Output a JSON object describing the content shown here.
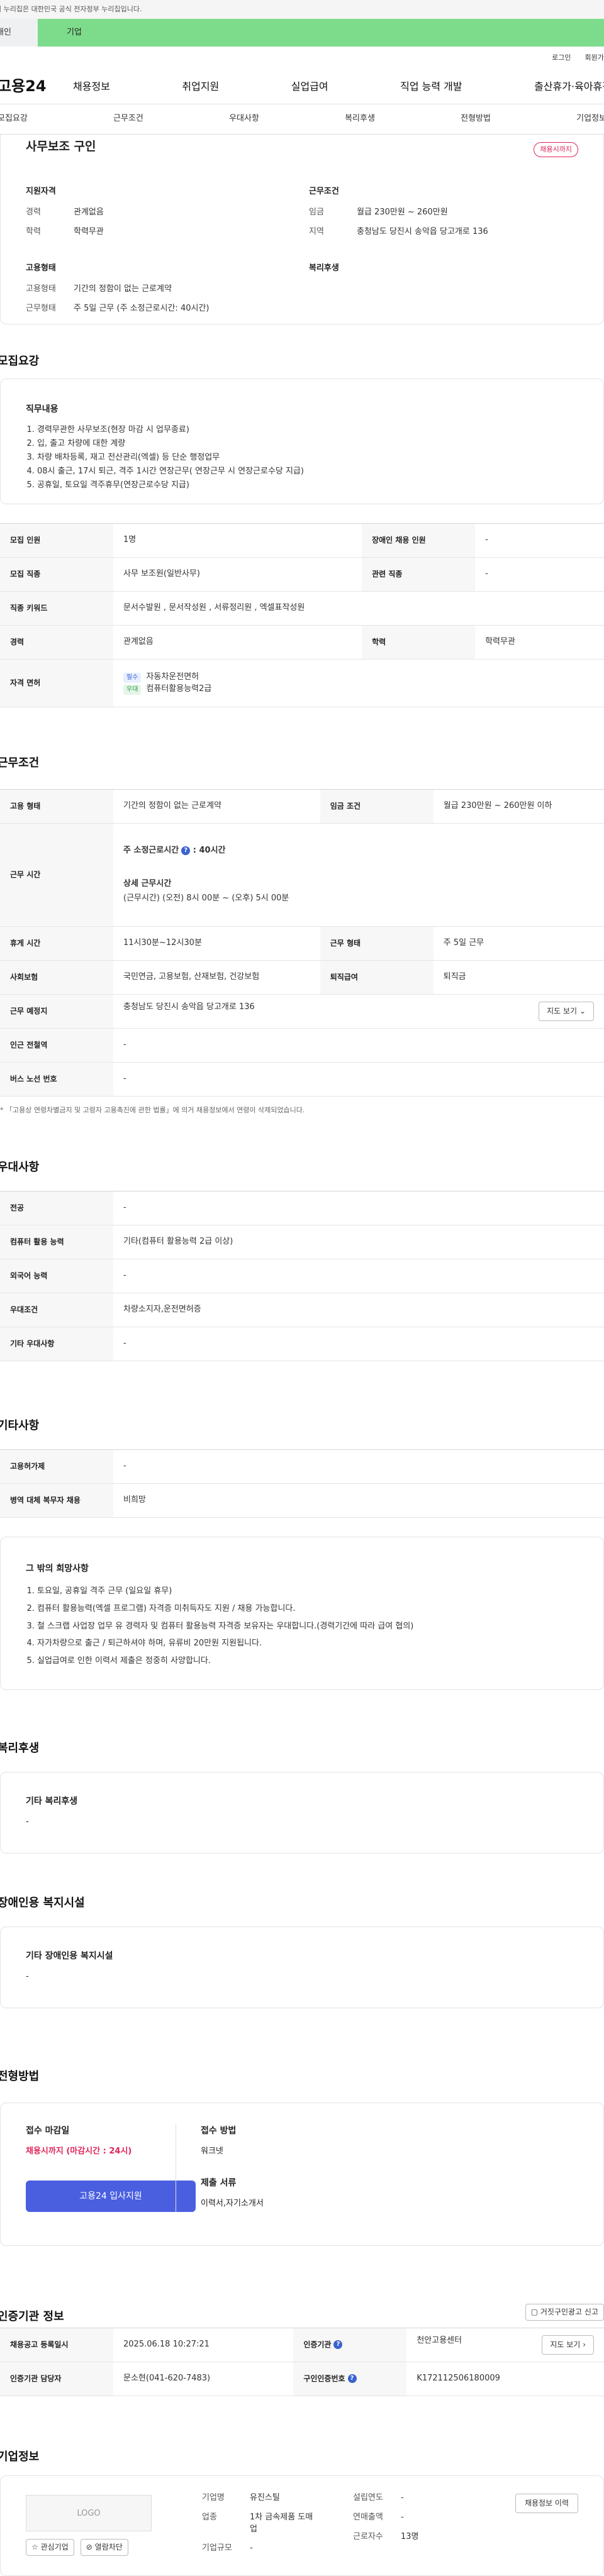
{
  "top": {
    "gov_notice": "이 누리집은 대한민국 공식 전자정부 누리집입니다.",
    "tab_person": "개인",
    "tab_company": "기업",
    "login": "로그인",
    "join": "회원가입"
  },
  "gnb": {
    "logo": "고용24",
    "menu": [
      "채용정보",
      "취업지원",
      "실업급여",
      "직업 능력 개발",
      "출산휴가·육아휴직"
    ]
  },
  "subnav": [
    "모집요강",
    "근무조건",
    "우대사항",
    "복리후생",
    "전형방법",
    "기업정보"
  ],
  "summary": {
    "job_title": "사무보조 구인",
    "badge": "채용시까지",
    "qual_title": "지원자격",
    "career_k": "경력",
    "career_v": "관계없음",
    "edu_k": "학력",
    "edu_v": "학력무관",
    "cond_title": "근무조건",
    "wage_k": "임금",
    "wage_v": "월급 230만원 ~ 260만원",
    "loc_k": "지역",
    "loc_v": "충청남도 당진시 송악읍 당고개로 136",
    "emp_title": "고용형태",
    "emptype_k": "고용형태",
    "emptype_v": "기간의 정함이 없는 근로계약",
    "worktype_k": "근무형태",
    "worktype_v": "주 5일 근무 (주 소정근로시간: 40시간)",
    "welfare_title": "복리후생"
  },
  "recruit": {
    "title": "모집요강",
    "duties_title": "직무내용",
    "duties": [
      "경력무관한 사무보조(현장 마감 시 업무종료)",
      "입, 출고 차량에 대한 계량",
      "차량 배차등록, 재고 전산관리(엑셀) 등 단순 행정업무",
      "08시 출근, 17시 퇴근, 격주 1시간 연장근무( 연장근무 시 연장근로수당 지급)",
      "공휴일, 토요일 격주휴무(연장근로수당 지급)"
    ],
    "rows": {
      "count_k": "모집 인원",
      "count_v": "1명",
      "disabled_k": "장애인 채용 인원",
      "disabled_v": "-",
      "job_k": "모집 직종",
      "job_v": "사무 보조원(일반사무)",
      "related_k": "관련 직종",
      "related_v": "-",
      "kw_k": "직종 키워드",
      "kw_v": "문서수발원 , 문서작성원 , 서류정리원 , 엑셀표작성원",
      "career_k": "경력",
      "career_v": "관계없음",
      "edu_k": "학력",
      "edu_v": "학력무관",
      "lic_k": "자격 면허",
      "lic1_tag": "필수",
      "lic1": "자동차운전면허",
      "lic2_tag": "우대",
      "lic2": "컴퓨터활용능력2급"
    }
  },
  "work": {
    "title": "근무조건",
    "type_k": "고용 형태",
    "type_v": "기간의 정함이 없는 근로계약",
    "wage_k": "임금 조건",
    "wage_v": "월급 230만원 ~ 260만원 이하",
    "time_k": "근무 시간",
    "weekly": "주 소정근로시간",
    "weekly_v": ": 40시간",
    "detail_t": "상세 근무시간",
    "detail_v": "(근무시간) (오전) 8시 00분 ~ (오후) 5시 00분",
    "rest_k": "휴게 시간",
    "rest_v": "11시30분~12시30분",
    "form_k": "근무 형태",
    "form_v": "주 5일 근무",
    "ins_k": "사회보험",
    "ins_v": "국민연금, 고용보험, 산재보험, 건강보험",
    "sev_k": "퇴직급여",
    "sev_v": "퇴직금",
    "place_k": "근무 예정지",
    "place_v": "충청남도 당진시 송악읍 당고개로 136",
    "map_btn": "지도 보기",
    "subway_k": "인근 전철역",
    "subway_v": "-",
    "bus_k": "버스 노선 번호",
    "bus_v": "-",
    "note": "* 「고용상 연령차별금지 및 고령자 고용촉진에 관한 법률」에 의거 채용정보에서 연령이 삭제되었습니다."
  },
  "pref": {
    "title": "우대사항",
    "major_k": "전공",
    "major_v": "-",
    "comp_k": "컴퓨터 활용 능력",
    "comp_v": "기타(컴퓨터 활용능력 2급 이상)",
    "lang_k": "외국어 능력",
    "lang_v": "-",
    "cond_k": "우대조건",
    "cond_v": "차량소지자,운전면허증",
    "etc_k": "기타 우대사항",
    "etc_v": "-"
  },
  "other": {
    "title": "기타사항",
    "hire_k": "고용허가제",
    "hire_v": "-",
    "army_k": "병역 대체 복무자 채용",
    "army_v": "비희망",
    "req_title": "그 밖의 희망사항",
    "req": [
      "토요일, 공휴일 격주 근무 (일요일 휴무)",
      "컴퓨터 활용능력(엑셀 프로그램) 자격증 미취득자도 지원 / 채용 가능합니다.",
      "철 스크랩 사업장 업무 유 경력자 및 컴퓨터 활용능력 자격증 보유자는 우대합니다.(경력기간에 따라 급여 협의)",
      "자가차량으로 출근 / 퇴근하셔야 하며, 유류비 20만원 지원됩니다.",
      "실업급여로 인한 이력서 제출은 정중히 사양합니다."
    ]
  },
  "welfare": {
    "title": "복리후생",
    "sub": "기타 복리후생",
    "val": "-"
  },
  "disab": {
    "title": "장애인용 복지시설",
    "sub": "기타 장애인용 복지시설",
    "val": "-"
  },
  "process": {
    "title": "전형방법",
    "deadline_t": "접수 마감일",
    "deadline_v": "채용시까지 (마감시간 : 24시)",
    "apply_btn": "고용24 입사지원",
    "method_t": "접수 방법",
    "method_v": "워크넷",
    "docs_t": "제출 서류",
    "docs_v": "이력서,자기소개서"
  },
  "cert": {
    "title": "인증기관 정보",
    "report_btn": "거짓구인광고 신고",
    "date_k": "채용공고 등록일시",
    "date_v": "2025.06.18 10:27:21",
    "org_k": "인증기관",
    "org_v": "천안고용센터",
    "map_btn": "지도 보기",
    "mgr_k": "인증기관 담당자",
    "mgr_v": "문소현(041-620-7483)",
    "id_k": "구인인증번호",
    "id_v": "K172112506180009"
  },
  "company": {
    "title": "기업정보",
    "logo": "LOGO",
    "fav_btn": "관심기업",
    "block_btn": "열람차단",
    "name_k": "기업명",
    "name_v": "유진스틸",
    "year_k": "설립연도",
    "year_v": "-",
    "ind_k": "업종",
    "ind_v": "1차 금속제품 도매업",
    "sales_k": "연매출액",
    "sales_v": "-",
    "emp_k": "근로자수",
    "emp_v": "13명",
    "scale_k": "기업규모",
    "scale_v": "-",
    "hist_btn": "채용정보 이력"
  },
  "colors": {
    "accent": "#4a5fe0",
    "badge": "#e0265a",
    "tab_green": "#7ddc8b"
  }
}
